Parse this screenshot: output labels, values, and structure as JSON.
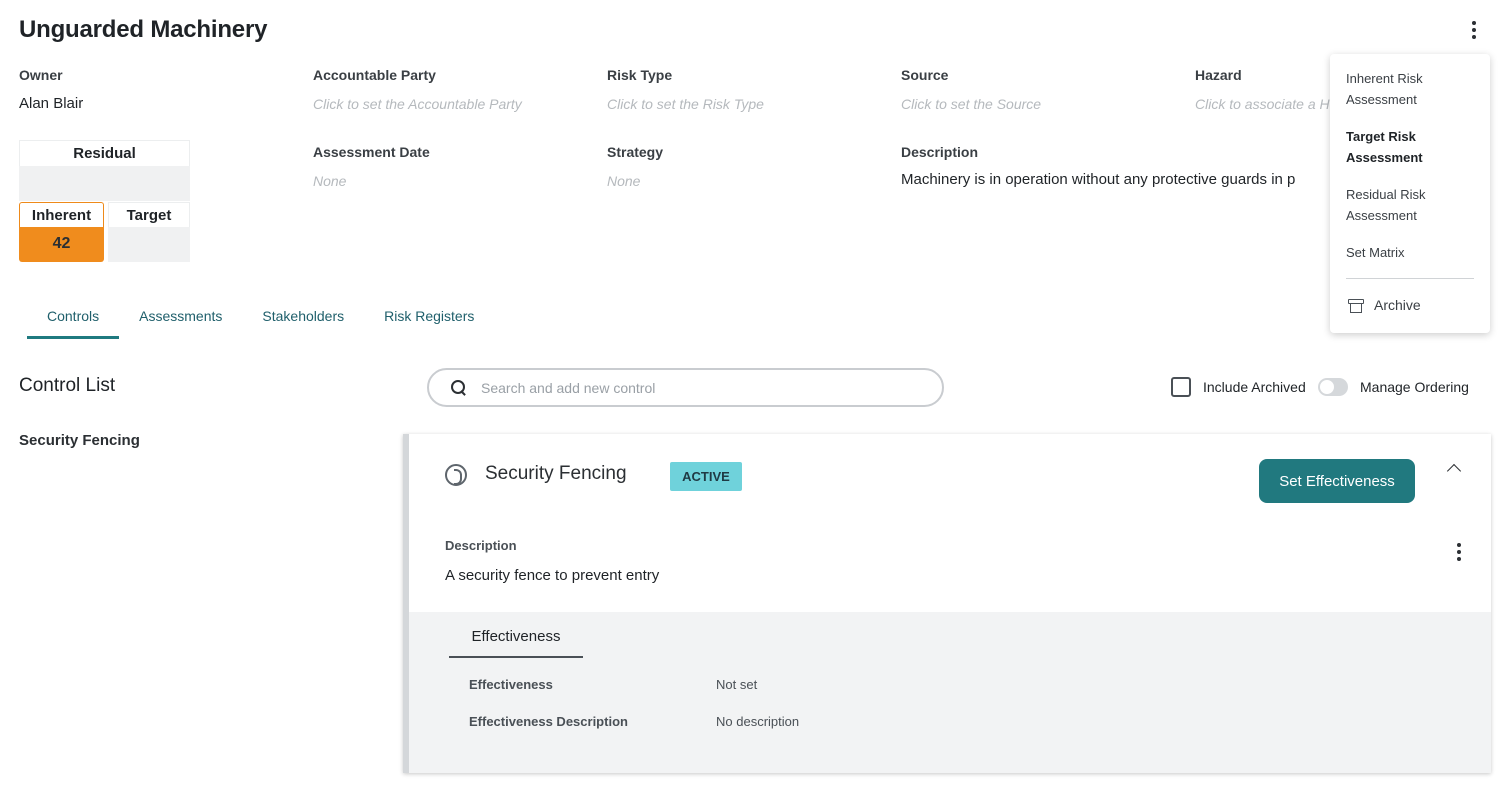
{
  "page": {
    "title": "Unguarded Machinery"
  },
  "fields": {
    "owner": {
      "label": "Owner",
      "value": "Alan Blair"
    },
    "accountable_party": {
      "label": "Accountable Party",
      "placeholder": "Click to set the Accountable Party"
    },
    "risk_type": {
      "label": "Risk Type",
      "placeholder": "Click to set the Risk Type"
    },
    "source": {
      "label": "Source",
      "placeholder": "Click to set the Source"
    },
    "hazard": {
      "label": "Hazard",
      "placeholder": "Click to associate a H"
    },
    "assessment_date": {
      "label": "Assessment Date",
      "value": "None"
    },
    "strategy": {
      "label": "Strategy",
      "value": "None"
    },
    "description": {
      "label": "Description",
      "value": "Machinery is in operation without any protective guards in p"
    }
  },
  "risk_scores": {
    "residual": {
      "label": "Residual",
      "value": ""
    },
    "inherent": {
      "label": "Inherent",
      "value": "42",
      "color": "#f08c1d"
    },
    "target": {
      "label": "Target",
      "value": ""
    }
  },
  "tabs": [
    {
      "label": "Controls",
      "active": true
    },
    {
      "label": "Assessments",
      "active": false
    },
    {
      "label": "Stakeholders",
      "active": false
    },
    {
      "label": "Risk Registers",
      "active": false
    }
  ],
  "control_list": {
    "title": "Control List",
    "search_placeholder": "Search and add new control",
    "include_archived_label": "Include Archived",
    "include_archived_checked": false,
    "manage_ordering_label": "Manage Ordering",
    "manage_ordering_on": false,
    "items": [
      "Security Fencing"
    ]
  },
  "control_card": {
    "title": "Security Fencing",
    "status": "ACTIVE",
    "status_color": "#6fd2db",
    "set_effectiveness_label": "Set Effectiveness",
    "button_color": "#21797f",
    "description_label": "Description",
    "description_value": "A security fence to prevent entry",
    "effectiveness_tab": "Effectiveness",
    "rows": [
      {
        "label": "Effectiveness",
        "value": "Not set"
      },
      {
        "label": "Effectiveness Description",
        "value": "No description"
      }
    ]
  },
  "menu": {
    "items": [
      {
        "label": "Inherent Risk Assessment",
        "bold": false
      },
      {
        "label": "Target Risk Assessment",
        "bold": true
      },
      {
        "label": "Residual Risk Assessment",
        "bold": false
      },
      {
        "label": "Set Matrix",
        "bold": false
      }
    ],
    "archive_label": "Archive"
  }
}
